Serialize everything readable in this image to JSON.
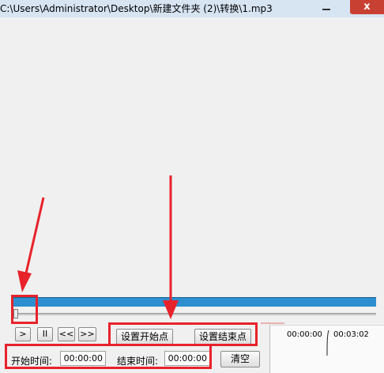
{
  "window": {
    "title": "C:\\Users\\Administrator\\Desktop\\新建文件夹 (2)\\转换\\1.mp3",
    "close_label": "x"
  },
  "player": {
    "controls": {
      "play": ">",
      "pause": "II",
      "rewind": "<<",
      "forward": ">>"
    },
    "set_start_label": "设置开始点",
    "set_end_label": "设置结束点",
    "start_time_label": "开始时间:",
    "start_time_value": "00:00:00",
    "end_time_label": "结束时间:",
    "end_time_value": "00:00:00",
    "clear_label": "清空",
    "current_time": "00:00:00",
    "total_time": "00:03:02",
    "position": 0
  },
  "annotations": {
    "highlight_color": "#e8222b",
    "bar_color": "#2d8fcf"
  }
}
